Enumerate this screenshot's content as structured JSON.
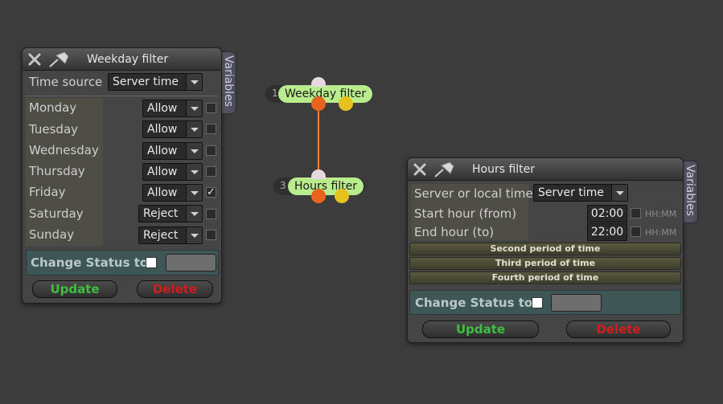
{
  "colors": {
    "canvas": "#3c3c3c",
    "update_text": "#3fbf3f",
    "delete_text": "#d41c1c",
    "node_label_bg": "#b8ec8c",
    "connector": "#f08040",
    "port_orange": "#e8641e",
    "port_yellow": "#e6c21e",
    "port_top": "#e8d8e0"
  },
  "weekday_panel": {
    "title": "Weekday filter",
    "side_tab": "Variables",
    "time_source_label": "Time source",
    "time_source_value": "Server time",
    "days": [
      {
        "label": "Monday",
        "value": "Allow",
        "checked": false
      },
      {
        "label": "Tuesday",
        "value": "Allow",
        "checked": false
      },
      {
        "label": "Wednesday",
        "value": "Allow",
        "checked": false
      },
      {
        "label": "Thursday",
        "value": "Allow",
        "checked": false
      },
      {
        "label": "Friday",
        "value": "Allow",
        "checked": true
      },
      {
        "label": "Saturday",
        "value": "Reject",
        "checked": false
      },
      {
        "label": "Sunday",
        "value": "Reject",
        "checked": false
      }
    ],
    "change_status_label": "Change Status to",
    "update_label": "Update",
    "delete_label": "Delete"
  },
  "hours_panel": {
    "title": "Hours filter",
    "side_tab": "Variables",
    "time_label": "Server or local time",
    "time_value": "Server time",
    "start_label": "Start hour (from)",
    "start_value": "02:00",
    "end_label": "End hour (to)",
    "end_value": "22:00",
    "format_hint": "HH:MM",
    "periods": [
      "Second period of time",
      "Third period of time",
      "Fourth period of time"
    ],
    "change_status_label": "Change Status to",
    "update_label": "Update",
    "delete_label": "Delete"
  },
  "nodes": [
    {
      "number": "1",
      "label": "Weekday filter"
    },
    {
      "number": "3",
      "label": "Hours filter"
    }
  ],
  "icons": {
    "close": "close-icon",
    "pin": "pin-icon",
    "checkmark": "✓"
  }
}
